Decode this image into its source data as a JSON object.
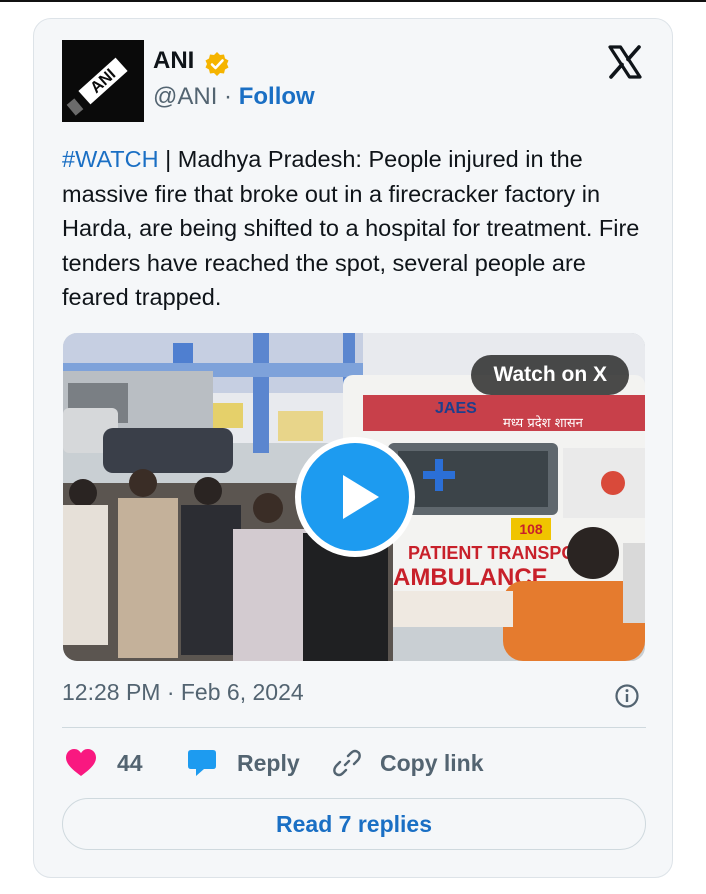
{
  "author": {
    "name": "ANI",
    "handle": "@ANI",
    "separator": "·",
    "follow_label": "Follow",
    "avatar_text": "ANI",
    "verified_color": "#f5b400"
  },
  "tweet": {
    "hashtag": "#WATCH",
    "text": " | Madhya Pradesh: People injured in the massive fire that broke out in a firecracker factory in Harda, are being shifted to a hospital for treatment. Fire tenders have reached the spot, several people are feared trapped."
  },
  "media": {
    "watch_label": "Watch on X",
    "play_icon": "play-icon",
    "scene_text": {
      "ambulance": "AMBULANCE",
      "patient_transport": "PATIENT TRANSPORT",
      "hindi_header": "मध्य प्रदेश शासन",
      "brand": "JAES",
      "number": "108"
    }
  },
  "meta": {
    "timestamp": "12:28 PM · Feb 6, 2024"
  },
  "actions": {
    "like_count": "44",
    "reply_label": "Reply",
    "copy_label": "Copy link",
    "read_replies_label": "Read 7 replies"
  },
  "colors": {
    "accent": "#1d9bf0",
    "link": "#1a6fc4",
    "heart": "#f91880"
  }
}
